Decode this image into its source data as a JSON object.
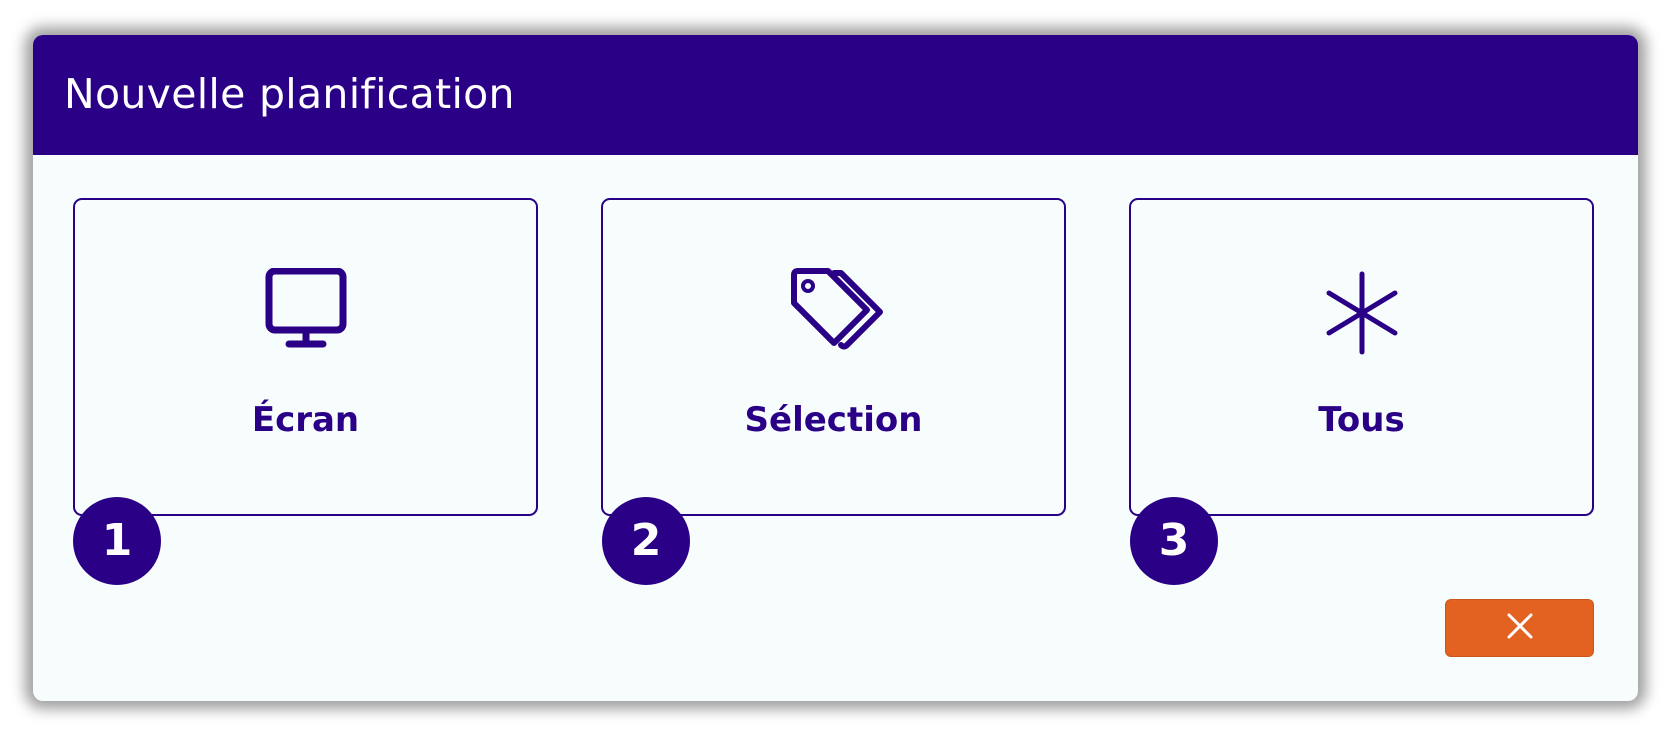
{
  "dialog": {
    "title": "Nouvelle planification"
  },
  "options": [
    {
      "label": "Écran",
      "icon": "monitor-icon",
      "step": "1"
    },
    {
      "label": "Sélection",
      "icon": "tags-icon",
      "step": "2"
    },
    {
      "label": "Tous",
      "icon": "asterisk-icon",
      "step": "3"
    }
  ],
  "close_button": {
    "icon": "close-icon"
  },
  "colors": {
    "header": "#2a0086",
    "accent": "#2a0086",
    "background": "#f7fdfd",
    "close_button": "#e36222"
  }
}
